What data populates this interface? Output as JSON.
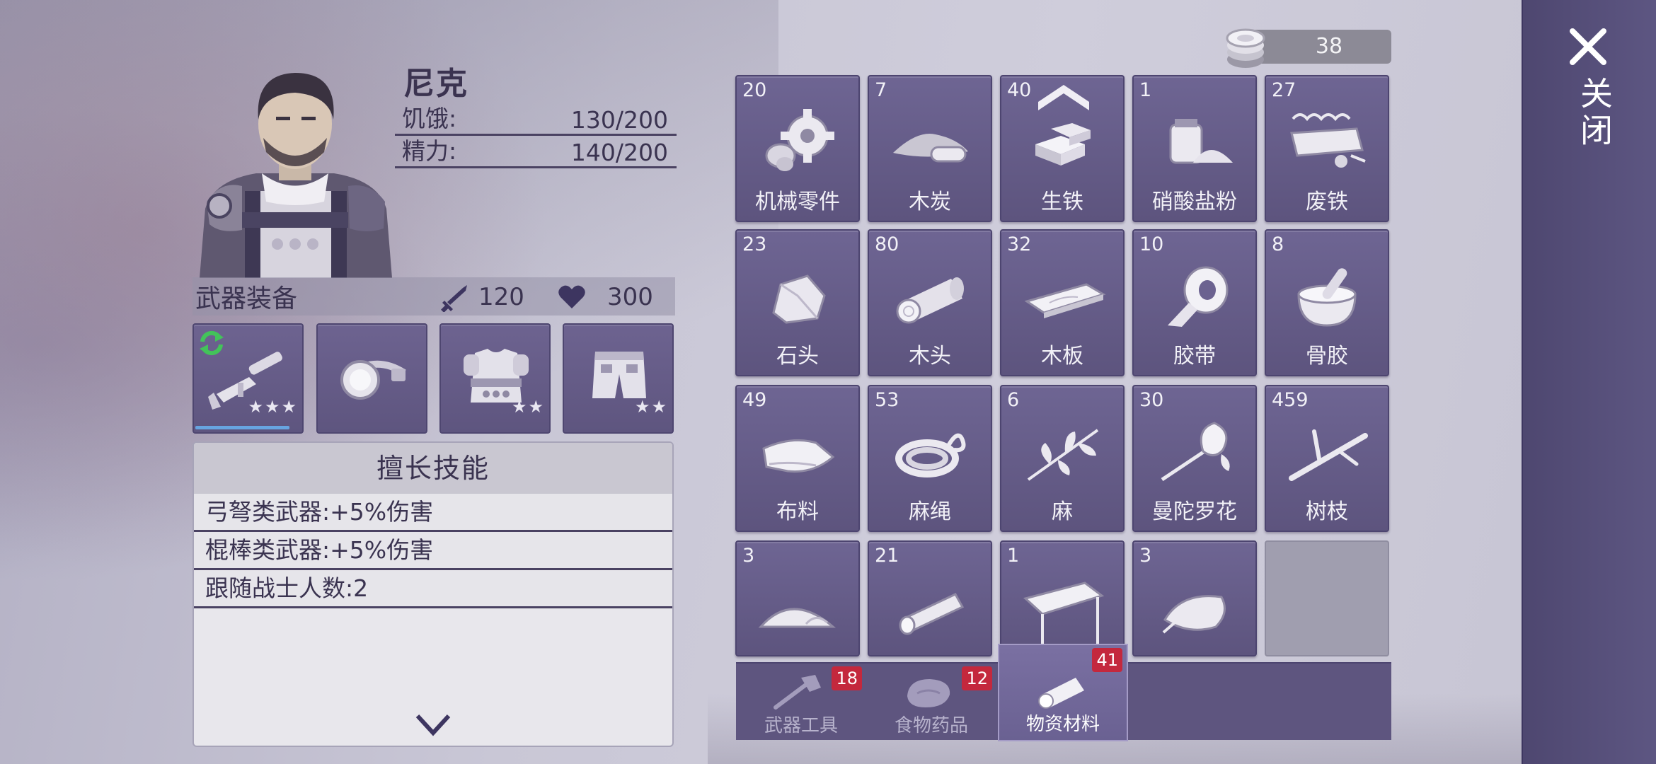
{
  "character": {
    "name": "尼克",
    "hunger_label": "饥饿:",
    "hunger_value": "130/200",
    "energy_label": "精力:",
    "energy_value": "140/200"
  },
  "equipment": {
    "title": "武器装备",
    "attack": "120",
    "health": "300",
    "slots": [
      {
        "item": "rifle-icon",
        "stars": "★★★",
        "star_count": 3,
        "durability": 0.9,
        "swap_icon": "refresh-icon"
      },
      {
        "item": "headlamp-icon",
        "stars": "",
        "star_count": 0
      },
      {
        "item": "armor-vest-icon",
        "stars": "★★",
        "star_count": 2
      },
      {
        "item": "shorts-icon",
        "stars": "★★",
        "star_count": 2
      }
    ]
  },
  "skills": {
    "title": "擅长技能",
    "items": [
      "弓弩类武器:+5%伤害",
      "棍棒类武器:+5%伤害",
      "跟随战士人数:2"
    ],
    "more_icon": "chevron-down-icon"
  },
  "currency": {
    "value": "38",
    "icon": "coin-stack-icon"
  },
  "inventory": [
    {
      "count": "20",
      "label": "机械零件",
      "icon": "gear-icon"
    },
    {
      "count": "7",
      "label": "木炭",
      "icon": "charcoal-icon"
    },
    {
      "count": "40",
      "label": "生铁",
      "icon": "iron-ingot-icon",
      "upgrade": true
    },
    {
      "count": "1",
      "label": "硝酸盐粉",
      "icon": "saltpeter-icon"
    },
    {
      "count": "27",
      "label": "废铁",
      "icon": "scrap-metal-icon"
    },
    {
      "count": "23",
      "label": "石头",
      "icon": "stone-icon"
    },
    {
      "count": "80",
      "label": "木头",
      "icon": "log-icon"
    },
    {
      "count": "32",
      "label": "木板",
      "icon": "plank-icon"
    },
    {
      "count": "10",
      "label": "胶带",
      "icon": "tape-icon"
    },
    {
      "count": "8",
      "label": "骨胶",
      "icon": "bone-glue-icon"
    },
    {
      "count": "49",
      "label": "布料",
      "icon": "cloth-icon"
    },
    {
      "count": "53",
      "label": "麻绳",
      "icon": "rope-icon"
    },
    {
      "count": "6",
      "label": "麻",
      "icon": "hemp-icon"
    },
    {
      "count": "30",
      "label": "曼陀罗花",
      "icon": "datura-flower-icon"
    },
    {
      "count": "459",
      "label": "树枝",
      "icon": "branch-icon"
    },
    {
      "count": "3",
      "label": "",
      "icon": "powder-pile-icon"
    },
    {
      "count": "21",
      "label": "",
      "icon": "pipe-icon"
    },
    {
      "count": "1",
      "label": "",
      "icon": "awning-icon"
    },
    {
      "count": "3",
      "label": "",
      "icon": "sack-icon"
    }
  ],
  "tabs": [
    {
      "label": "武器工具",
      "badge": "18",
      "icon": "axe-icon",
      "active": false
    },
    {
      "label": "食物药品",
      "badge": "12",
      "icon": "meat-icon",
      "active": false
    },
    {
      "label": "物资材料",
      "badge": "41",
      "icon": "log-icon",
      "active": true
    }
  ],
  "close": {
    "label": "关闭",
    "icon": "close-icon"
  }
}
